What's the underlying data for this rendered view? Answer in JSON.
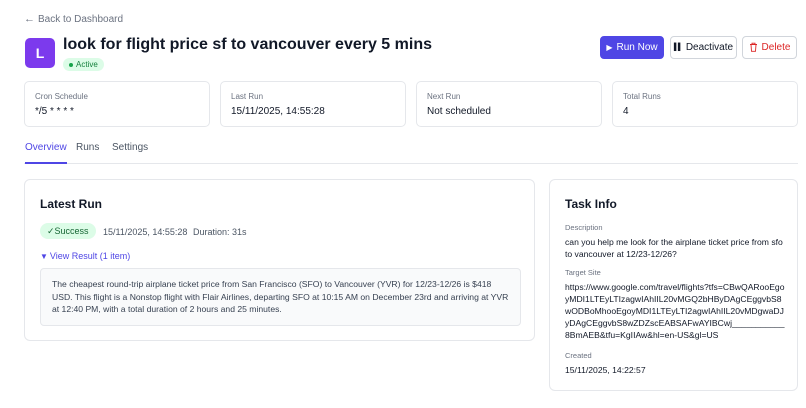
{
  "header": {
    "back_label": "Back to Dashboard",
    "avatar_letter": "L",
    "title": "look for flight price sf to vancouver every 5 mins",
    "status": "Active",
    "run_now_label": "Run Now",
    "deactivate_label": "Deactivate",
    "delete_label": "Delete"
  },
  "stats": [
    {
      "label": "Cron Schedule",
      "value": "*/5 * * * *"
    },
    {
      "label": "Last Run",
      "value": "15/11/2025, 14:55:28"
    },
    {
      "label": "Next Run",
      "value": "Not scheduled"
    },
    {
      "label": "Total Runs",
      "value": "4"
    }
  ],
  "tabs": [
    {
      "label": "Overview",
      "active": true
    },
    {
      "label": "Runs",
      "active": false
    },
    {
      "label": "Settings",
      "active": false
    }
  ],
  "latest_run": {
    "title": "Latest Run",
    "status": "✓Success",
    "time": "15/11/2025, 14:55:28",
    "duration": "Duration: 31s",
    "view_result": "View Result (1 item)",
    "result_text": "The cheapest round-trip airplane ticket price from San Francisco (SFO) to Vancouver (YVR) for 12/23-12/26 is $418 USD. This flight is a Nonstop flight with Flair Airlines, departing SFO at 10:15 AM on December 23rd and arriving at YVR at 12:40 PM, with a total duration of 2 hours and 25 minutes."
  },
  "task_info": {
    "title": "Task Info",
    "description_label": "Description",
    "description": "can you help me look for the airplane ticket price from sfo to vancouver at 12/23-12/26?",
    "target_label": "Target Site",
    "target": "https://www.google.com/travel/flights?tfs=CBwQARooEgoyMDI1LTEyLTIzagwIAhIIL20vMGQ2bHByDAgCEggvbS8wODBoMhooEgoyMDI1LTEyLTI2agwIAhIIL20vMDgwaDJyDAgCEggvbS8wZDZscEABSAFwAYIBCwj___________8BmAEB&tfu=KgIIAw&hl=en-US&gl=US",
    "created_label": "Created",
    "created": "15/11/2025, 14:22:57"
  }
}
